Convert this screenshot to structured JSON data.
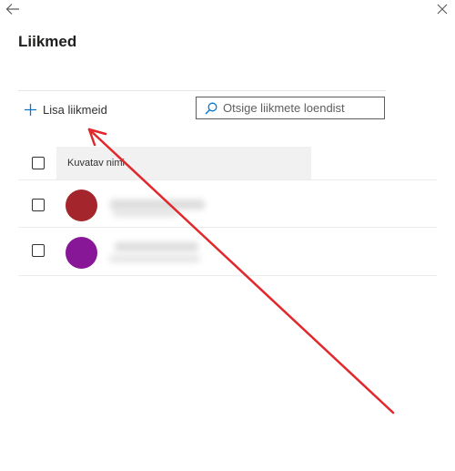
{
  "page": {
    "title": "Liikmed"
  },
  "toolbar": {
    "add_members_label": "Lisa liikmeid",
    "search_placeholder": "Otsige liikmete loendist"
  },
  "table": {
    "columns": [
      "Kuvatav nimi"
    ],
    "rows": [
      {
        "avatar_color": "#a4262c",
        "name": ""
      },
      {
        "avatar_color": "#881798",
        "name": ""
      }
    ]
  },
  "icons": {
    "back": "arrow-left-icon",
    "close": "close-icon",
    "add": "plus-icon",
    "search": "search-icon"
  },
  "annotation": {
    "color": "#e0282d"
  }
}
